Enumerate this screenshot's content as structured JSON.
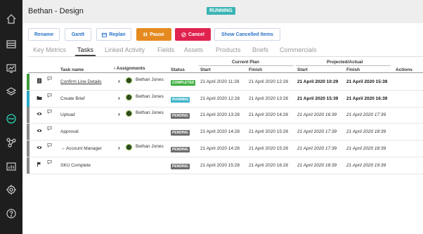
{
  "app": {
    "title": "Bethan - Design",
    "status": "RUNNING"
  },
  "sidebar": {
    "items": [
      {
        "icon": "home-icon",
        "name": "home"
      },
      {
        "icon": "list-icon",
        "name": "list"
      },
      {
        "icon": "monitor-icon",
        "name": "monitor"
      },
      {
        "icon": "layers-icon",
        "name": "layers"
      },
      {
        "icon": "workflow-icon",
        "name": "workflow",
        "active": true
      },
      {
        "icon": "network-icon",
        "name": "network"
      },
      {
        "icon": "bar-chart-icon",
        "name": "reports"
      },
      {
        "icon": "settings-icon",
        "name": "settings"
      },
      {
        "icon": "help-icon",
        "name": "help"
      }
    ]
  },
  "toolbar": {
    "rename": "Rename",
    "gantt": "Gantt",
    "replan": "Replan",
    "pause": "Pause",
    "cancel": "Cancel",
    "show_cancelled": "Show Cancelled Items"
  },
  "tabs": [
    "Key Metrics",
    "Tasks",
    "Linked Activity",
    "Fields",
    "Assets",
    "Products",
    "Briefs",
    "Commercials"
  ],
  "active_tab": "Tasks",
  "table": {
    "group_current_plan": "Current Plan",
    "group_projected": "Projected/Actual",
    "col_task": "Task name",
    "col_assignments": "Assignments",
    "col_status": "Status",
    "col_start": "Start",
    "col_finish": "Finish",
    "col_pstart": "Start",
    "col_pfinish": "Finish",
    "col_actions": "Actions",
    "rows": [
      {
        "icon": "document-icon",
        "stripe": "#3c9a3c",
        "task": "Confirm Line Details",
        "link": true,
        "assignee": "Bethan Jones",
        "status": "COMPLETED",
        "status_color": "#3fae3f",
        "start": "21 April 2020 11:28",
        "finish": "21 April 2020 12:28",
        "pstart": "21 April 2020 10:29",
        "pfinish": "21 April 2020 15:39",
        "pstyle": "bold"
      },
      {
        "icon": "folder-icon",
        "stripe": "#2aa8c8",
        "task": "Create Brief",
        "link": false,
        "assignee": "Bethan Jones",
        "status": "RUNNING",
        "status_color": "#3cb4c8",
        "start": "21 April 2020 12:28",
        "finish": "21 April 2020 13:28",
        "pstart": "21 April 2020 15:39",
        "pfinish": "21 April 2020 16:39",
        "pstyle": "bold"
      },
      {
        "icon": "eye-icon",
        "stripe": "#888",
        "task": "Upload",
        "link": false,
        "assignee": "Bethan Jones",
        "status": "PENDING",
        "status_color": "#6d6d6d",
        "start": "21 April 2020 13:28",
        "finish": "21 April 2020 14:28",
        "pstart": "21 April 2020 16:39",
        "pfinish": "21 April 2020 17:39",
        "pstyle": "italic"
      },
      {
        "icon": "eye-icon",
        "stripe": "#888",
        "task": "Approval",
        "link": false,
        "assignee": "",
        "status": "PENDING",
        "status_color": "#6d6d6d",
        "start": "21 April 2020 14:28",
        "finish": "21 April 2020 15:28",
        "pstart": "21 April 2020 17:39",
        "pfinish": "21 April 2020 18:39",
        "pstyle": "italic"
      },
      {
        "icon": "eye-icon",
        "stripe": "#888",
        "task": "→ Account Manager",
        "link": false,
        "assignee": "Bethan Jones",
        "status": "PENDING",
        "status_color": "#6d6d6d",
        "start": "21 April 2020 14:28",
        "finish": "21 April 2020 15:28",
        "pstart": "21 April 2020 17:39",
        "pfinish": "21 April 2020 18:39",
        "pstyle": "italic"
      },
      {
        "icon": "flag-icon",
        "stripe": "#888",
        "task": "SKU Complete",
        "link": false,
        "assignee": "",
        "status": "PENDING",
        "status_color": "#6d6d6d",
        "start": "21 April 2020 15:28",
        "finish": "21 April 2020 16:28",
        "pstart": "21 April 2020 18:39",
        "pfinish": "21 April 2020 19:39",
        "pstyle": "italic"
      }
    ]
  }
}
